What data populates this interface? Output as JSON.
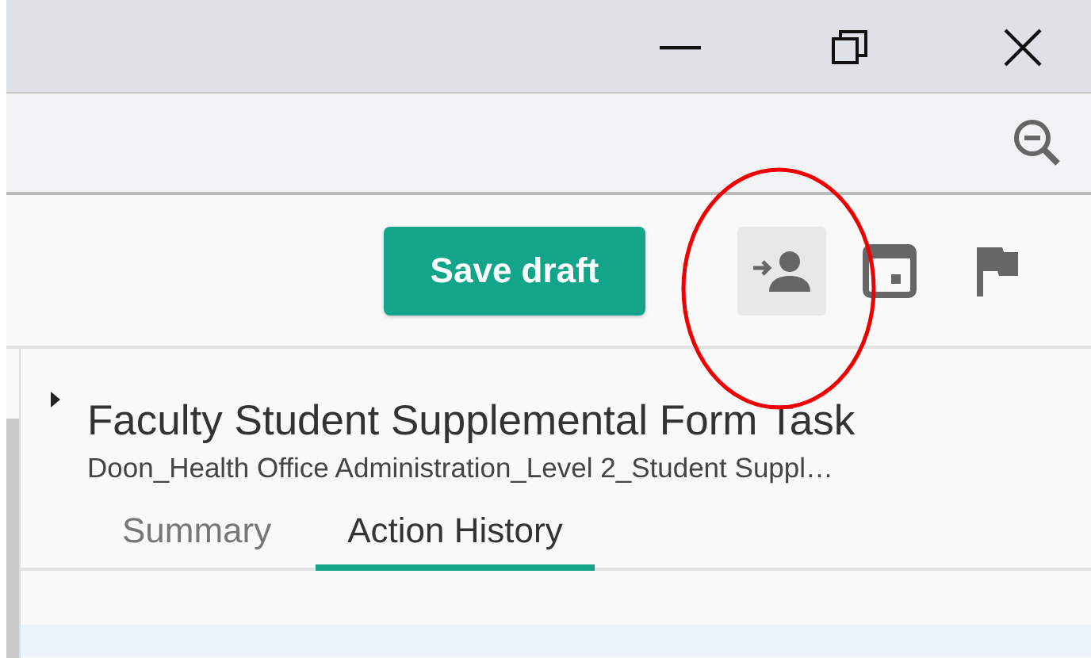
{
  "toolbar": {
    "save_button": "Save draft",
    "icon_buttons": [
      {
        "kind": "assign",
        "selected": true
      },
      {
        "kind": "calendar",
        "selected": false
      },
      {
        "kind": "flag",
        "selected": false
      }
    ]
  },
  "task": {
    "title": "Faculty Student Supplemental Form Task",
    "subtitle": "Doon_Health Office Administration_Level 2_Student Suppl…",
    "expanded": false
  },
  "tabs": [
    {
      "label": "Summary",
      "selected": false
    },
    {
      "label": "Action History",
      "selected": true
    }
  ]
}
